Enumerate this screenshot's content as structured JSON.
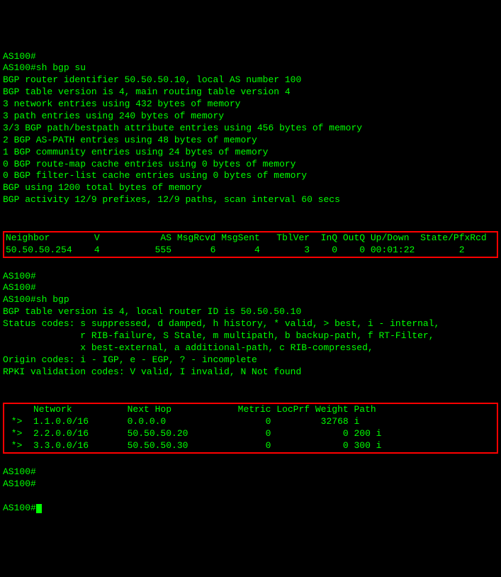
{
  "lines": [
    "AS100#",
    "AS100#sh bgp su",
    "BGP router identifier 50.50.50.10, local AS number 100",
    "BGP table version is 4, main routing table version 4",
    "3 network entries using 432 bytes of memory",
    "3 path entries using 240 bytes of memory",
    "3/3 BGP path/bestpath attribute entries using 456 bytes of memory",
    "2 BGP AS-PATH entries using 48 bytes of memory",
    "1 BGP community entries using 24 bytes of memory",
    "0 BGP route-map cache entries using 0 bytes of memory",
    "0 BGP filter-list cache entries using 0 bytes of memory",
    "BGP using 1200 total bytes of memory",
    "BGP activity 12/9 prefixes, 12/9 paths, scan interval 60 secs",
    ""
  ],
  "neighbor_box": [
    "Neighbor        V           AS MsgRcvd MsgSent   TblVer  InQ OutQ Up/Down  State/PfxRcd",
    "50.50.50.254    4          555       6       4        3    0    0 00:01:22        2"
  ],
  "mid_lines": [
    "AS100#",
    "AS100#",
    "AS100#sh bgp",
    "BGP table version is 4, local router ID is 50.50.50.10",
    "Status codes: s suppressed, d damped, h history, * valid, > best, i - internal,",
    "              r RIB-failure, S Stale, m multipath, b backup-path, f RT-Filter,",
    "              x best-external, a additional-path, c RIB-compressed,",
    "Origin codes: i - IGP, e - EGP, ? - incomplete",
    "RPKI validation codes: V valid, I invalid, N Not found",
    ""
  ],
  "route_box": [
    "     Network          Next Hop            Metric LocPrf Weight Path",
    " *>  1.1.0.0/16       0.0.0.0                  0         32768 i",
    " *>  2.2.0.0/16       50.50.50.20              0             0 200 i",
    " *>  3.3.0.0/16       50.50.50.30              0             0 300 i"
  ],
  "tail_lines": [
    "AS100#",
    "AS100#"
  ],
  "prompt": "AS100#"
}
